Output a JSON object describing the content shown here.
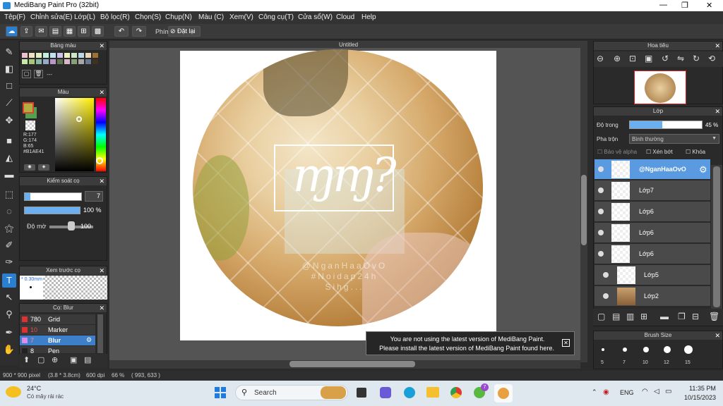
{
  "window": {
    "title": "MediBang Paint Pro (32bit)",
    "min": "—",
    "max": "❐",
    "close": "✕"
  },
  "menu": [
    "Tệp(F)",
    "Chỉnh sửa(E)",
    "Lớp(L)",
    "Bộ lọc(R)",
    "Chọn(S)",
    "Chụp(N)",
    "Màu (C)",
    "Xem(V)",
    "Công cụ(T)",
    "Cửa sổ(W)",
    "Cloud",
    "Help"
  ],
  "toolbar": {
    "shortcut_label": "Phím",
    "reset_label": "Đặt lại"
  },
  "palette": {
    "title": "Bảng màu",
    "empty_label": "---"
  },
  "color": {
    "title": "Màu",
    "r": "R:177",
    "g": "G:174",
    "b": "B:65",
    "hex": "#B1AE41",
    "fg": "#b1ae41",
    "bg": "#55a050"
  },
  "brush_control": {
    "title": "Kiểm soát cọ",
    "size": "7",
    "opacity": "100 %",
    "density_label": "Độ mờ",
    "density_value": "100"
  },
  "preview": {
    "title": "Xem trước cọ",
    "size_label": "* 0.30mm"
  },
  "brush_list": {
    "title": "Cọ: Blur",
    "items": [
      {
        "size": "780",
        "name": "Grid",
        "color": "#e03030"
      },
      {
        "size": "10",
        "name": "Marker",
        "color": "#e03030"
      },
      {
        "size": "7",
        "name": "Blur",
        "color": "#e28be6"
      },
      {
        "size": "8",
        "name": "Pen",
        "color": "#222222"
      }
    ]
  },
  "canvas": {
    "tab": "Untitled",
    "watermark": [
      "@NganHaaOvO",
      "#Noidap24h",
      "Sihg..."
    ]
  },
  "navigator": {
    "title": "Hoa tiêu"
  },
  "layers": {
    "title": "Lớp",
    "opacity_label": "Độ trong",
    "opacity_value": "45 %",
    "blend_label": "Pha trộn",
    "blend_value": "Bình thường",
    "protect_alpha": "Bảo vệ alpha",
    "clipping": "Xén bớt",
    "lock": "Khóa",
    "items": [
      "@NganHaaOvO",
      "Lớp7",
      "Lớp6",
      "Lớp6",
      "Lớp6",
      "Lớp5",
      "Lớp2"
    ]
  },
  "brush_size": {
    "title": "Brush Size",
    "sizes": [
      "5",
      "7",
      "10",
      "12",
      "15"
    ]
  },
  "notification": {
    "line1": "You are not using the latest version of MediBang Paint.",
    "line2": "Please install the latest version of MediBang Paint found here."
  },
  "status": {
    "dimensions": "900 * 900 pixel",
    "size_cm": "(3.8 * 3.8cm)",
    "dpi": "600 dpi",
    "zoom": "66 %",
    "cursor": "( 993, 633 )"
  },
  "taskbar": {
    "temp": "24°C",
    "weather": "Có mây rải rác",
    "search": "Search",
    "lang": "ENG",
    "time": "11:35 PM",
    "date": "10/15/2023",
    "badge": "7"
  }
}
